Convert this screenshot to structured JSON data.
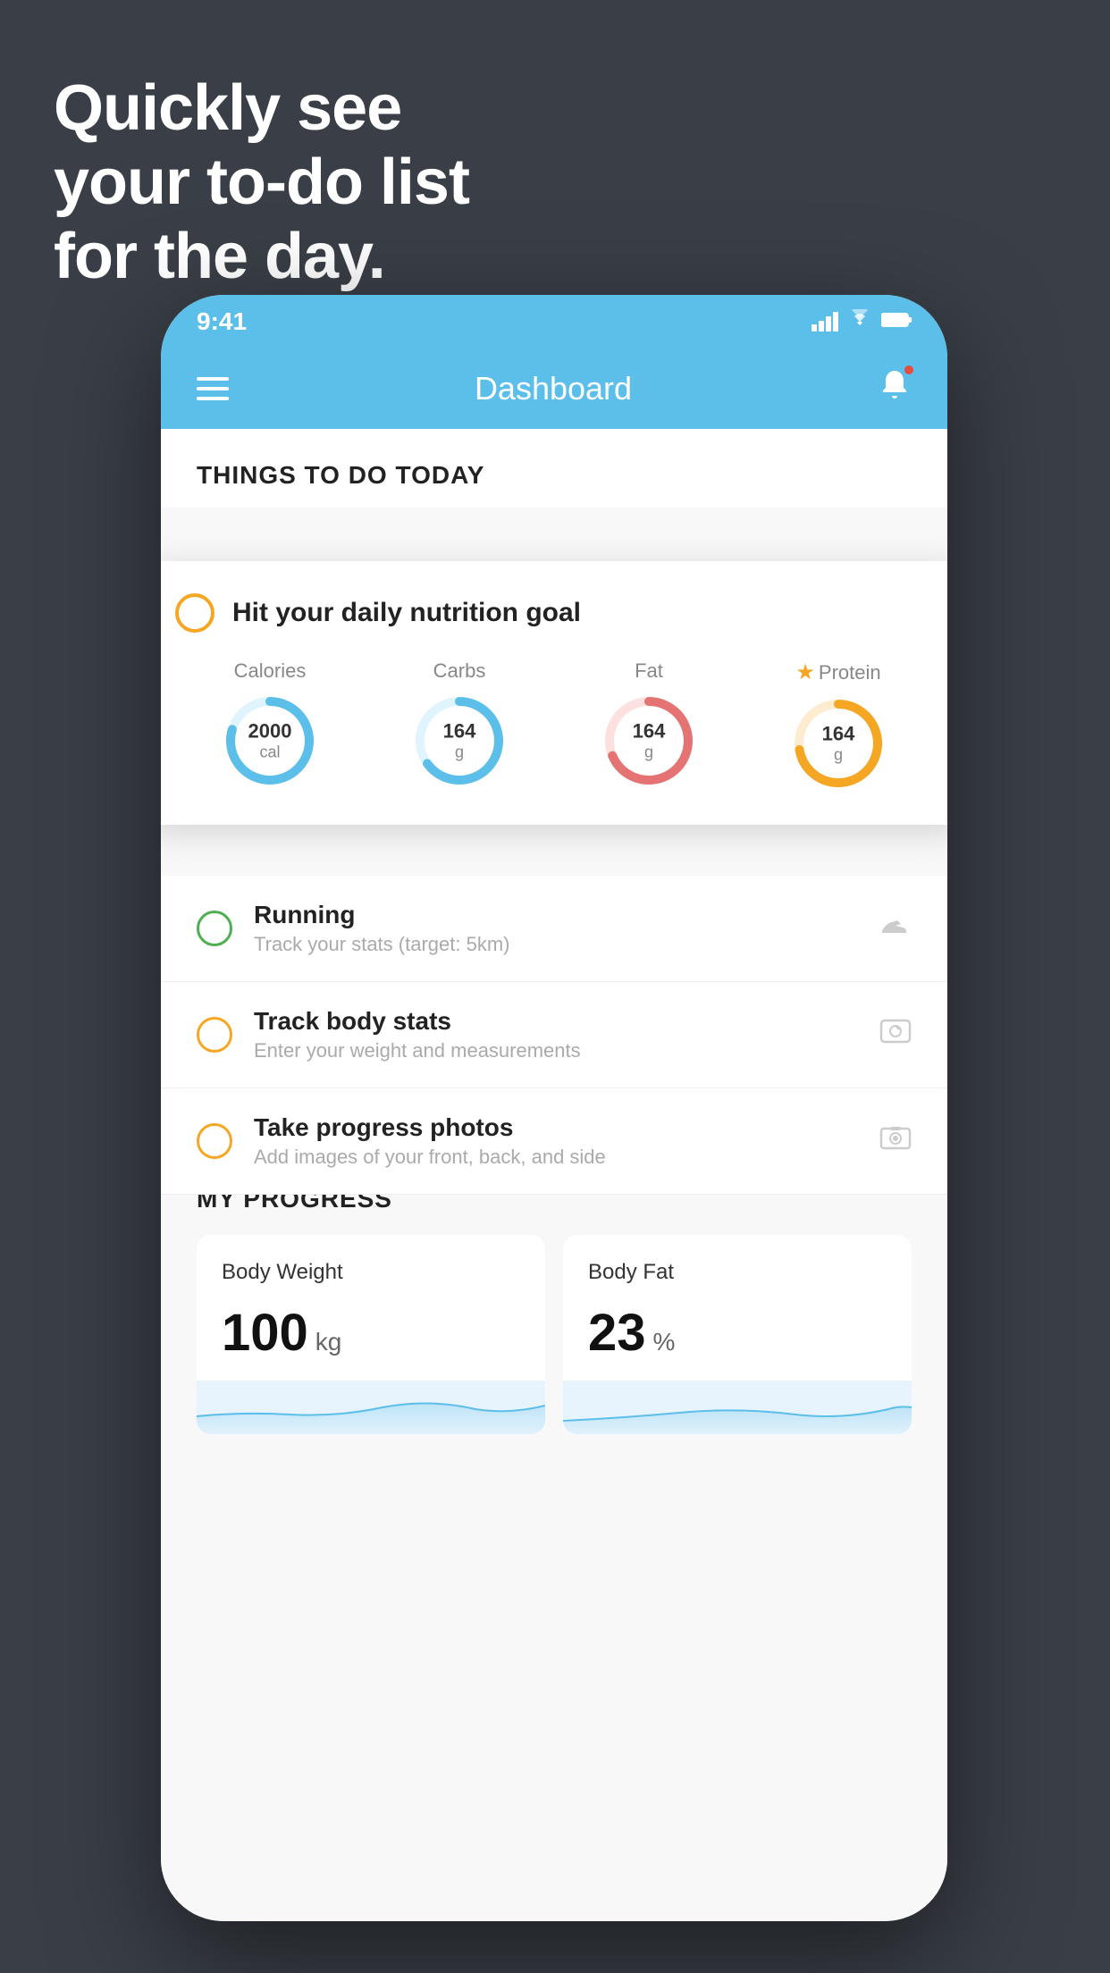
{
  "hero": {
    "line1": "Quickly see",
    "line2": "your to-do list",
    "line3": "for the day."
  },
  "status_bar": {
    "time": "9:41"
  },
  "nav": {
    "title": "Dashboard"
  },
  "things_section": {
    "title": "THINGS TO DO TODAY"
  },
  "floating_card": {
    "title": "Hit your daily nutrition goal",
    "nutrition": [
      {
        "label": "Calories",
        "value": "2000",
        "unit": "cal",
        "color": "#5bbfea",
        "star": false
      },
      {
        "label": "Carbs",
        "value": "164",
        "unit": "g",
        "color": "#5bbfea",
        "star": false
      },
      {
        "label": "Fat",
        "value": "164",
        "unit": "g",
        "color": "#e57373",
        "star": false
      },
      {
        "label": "Protein",
        "value": "164",
        "unit": "g",
        "color": "#f5a623",
        "star": true
      }
    ]
  },
  "todo_items": [
    {
      "name": "Running",
      "sub": "Track your stats (target: 5km)",
      "check_color": "green",
      "icon": "shoe-icon"
    },
    {
      "name": "Track body stats",
      "sub": "Enter your weight and measurements",
      "check_color": "yellow",
      "icon": "scale-icon"
    },
    {
      "name": "Take progress photos",
      "sub": "Add images of your front, back, and side",
      "check_color": "yellow",
      "icon": "photo-icon"
    }
  ],
  "progress_section": {
    "title": "MY PROGRESS",
    "cards": [
      {
        "title": "Body Weight",
        "value": "100",
        "unit": "kg"
      },
      {
        "title": "Body Fat",
        "value": "23",
        "unit": "%"
      }
    ]
  }
}
